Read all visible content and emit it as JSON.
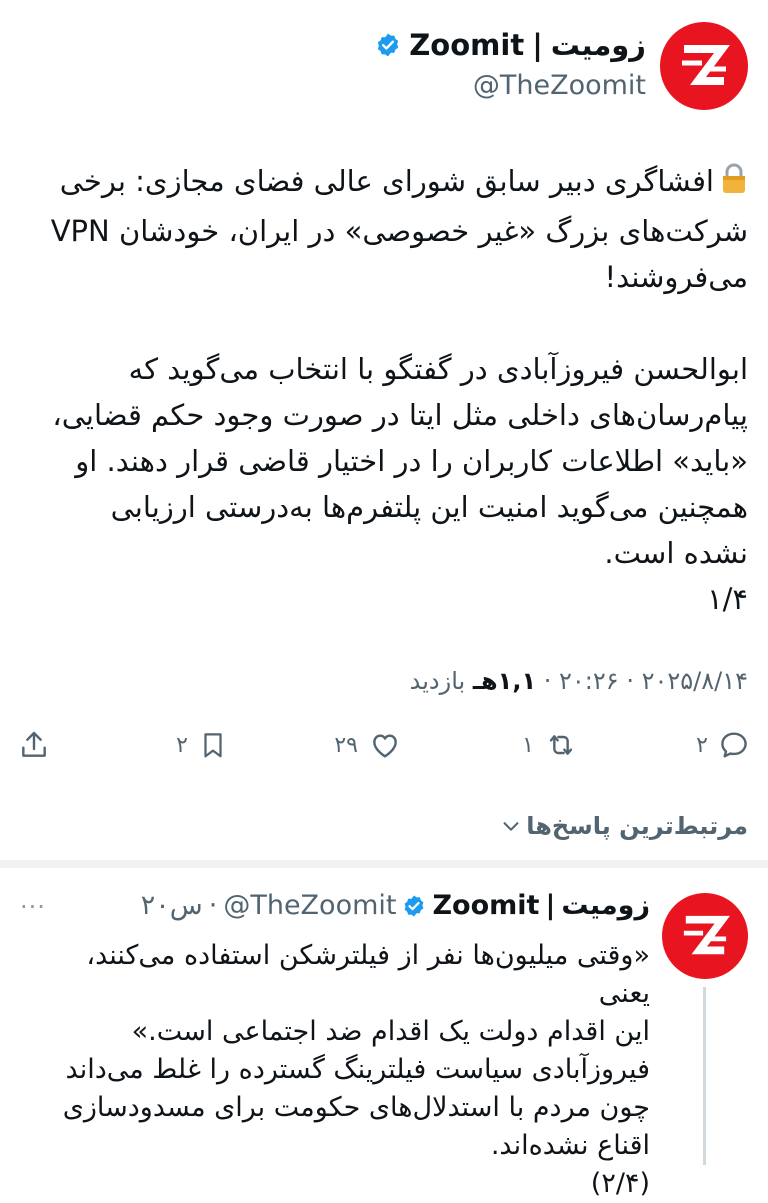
{
  "colors": {
    "brand_red": "#e8141f",
    "verified_blue": "#1d9bf0",
    "text_primary": "#0f1419",
    "text_secondary": "#536471"
  },
  "tweet": {
    "author": {
      "name_fa": "زومیت",
      "separator": "|",
      "name_en": "Zoomit",
      "handle": "@TheZoomit",
      "avatar_icon": "zoomit-logo",
      "verified_icon": "verified-badge-icon"
    },
    "lock_icon": "lock-icon",
    "lines": [
      "افشاگری دبیر سابق شورای عالی فضای مجازی: برخی",
      "شرکت‌های بزرگ «غیر خصوصی» در ایران، خودشان VPN",
      "می‌فروشند!",
      "",
      "ابوالحسن فیروزآبادی در گفتگو با انتخاب می‌گوید که",
      "پیام‌رسان‌های داخلی مثل ایتا در صورت وجود حکم قضایی،",
      "«باید» اطلاعات کاربران را در اختیار قاضی قرار دهند. او",
      "همچنین می‌گوید امنیت این پلتفرم‌ها به‌درستی ارزیابی",
      "نشده است.",
      "۱/۴"
    ],
    "meta": {
      "date": "۲۰۲۵/۸/۱۴",
      "time": "۲۰:۲۶",
      "views_count": "۱,۱هـ",
      "views_label": "بازدید",
      "dot": "·"
    },
    "actions": {
      "reply_count": "۲",
      "retweet_count": "۱",
      "like_count": "۲۹",
      "bookmark_count": "۲"
    }
  },
  "replies_sort": {
    "label": "مرتبط‌ترین پاسخ‌ها"
  },
  "reply": {
    "author": {
      "name_fa": "زومیت",
      "separator": "|",
      "name_en": "Zoomit",
      "handle": "@TheZoomit",
      "time": "۲۰س"
    },
    "more_label": "···",
    "lines": [
      "«وقتی میلیون‌ها نفر از فیلترشکن استفاده می‌کنند، یعنی",
      "این اقدام دولت یک اقدام ضد اجتماعی است.»",
      "فیروزآبادی سیاست فیلترینگ گسترده را غلط می‌داند",
      "چون مردم با استدلال‌های حکومت برای مسدودسازی",
      "اقناع نشده‌اند.",
      "(۲/۴)"
    ]
  }
}
